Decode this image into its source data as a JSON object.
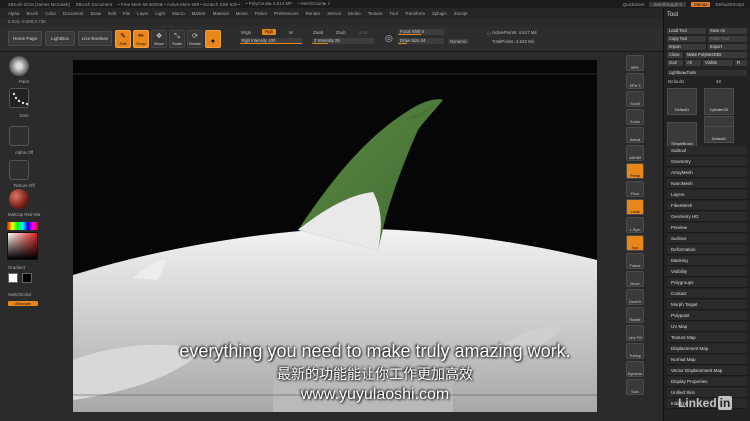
{
  "titlebar": {
    "app": "ZBrush 2018 [James McCaleb]",
    "doc": "ZBrush Document",
    "mem": "• Free Mem 58.303GB • Active Mem 599 • Scratch Disk 530 •",
    "poly": "• PolyCount▸ 4.614 MP",
    "mesh": "• MeshCount▸ 1",
    "quicksave": "QuickSave",
    "seethrough": "See-through  0",
    "menus": "Menus",
    "script": "DefaultZScript"
  },
  "menubar": [
    "Alpha",
    "Brush",
    "Color",
    "Document",
    "Draw",
    "Edit",
    "File",
    "Layer",
    "Light",
    "Macro",
    "Marker",
    "Material",
    "Movie",
    "Picker",
    "Preferences",
    "Render",
    "Stencil",
    "Stroke",
    "Texture",
    "Tool",
    "Transform",
    "Zplugin",
    "Zscript"
  ],
  "coords": "0.034,-0.088,0.736",
  "shelf": {
    "home": "Home Page",
    "lightbox": "LightBox",
    "live_boolean": "Live Boolean",
    "tools": [
      "Edit",
      "Draw",
      "Move",
      "Scale",
      "Rotate"
    ],
    "mrgb": "Mrgb",
    "rgb": "Rgb",
    "m": "M",
    "rgb_intensity": "Rgb Intensity 100",
    "zadd": "Zadd",
    "zsub": "Zsub",
    "zcut": "Zcut",
    "z_intensity": "Z Intensity 25",
    "focal_shift": "Focal Shift 0",
    "draw_size": "Draw Size 24",
    "dynamic": "Dynamic",
    "active_points": "ActivePoints: 4.617 Mil",
    "total_points": "TotalPoints: 4.632 Mil"
  },
  "left": {
    "brush": "Paint",
    "stroke": "Dots",
    "alpha": "Alpha Off",
    "texture": "Texture Off",
    "material": "MatCap Red Wa",
    "gradient": "Gradient",
    "switch": "SwitchColor",
    "alternate": "Alternate"
  },
  "right_tools": [
    "BPR",
    "SPix 3",
    "Scroll",
    "Zoom",
    "Actual",
    "AAHalf",
    "Persp",
    "Floor",
    "Local",
    "L.Sym",
    "Xyz",
    "Frame",
    "Move",
    "ZoomD",
    "Rotate",
    "Line Fill",
    "Transp",
    "Dynamic",
    "Solo"
  ],
  "tool_panel": {
    "title": "Tool",
    "load": "Load Tool",
    "save": "Save As",
    "copy": "Copy Tool",
    "paste": "Paste Tool",
    "import": "Import",
    "export": "Export",
    "clone": "Clone",
    "make_poly": "Make PolyMesh3D",
    "goz": "GoZ",
    "all": "All",
    "visible": "Visible",
    "r": "R",
    "lightbox_tools": "Lightbox▸Tools",
    "default_name": "Default1",
    "default_count": "48",
    "thumbs": [
      "Default1",
      "Cylinder3D",
      "PolyMesh3D",
      "SimpleBrush",
      "Default1"
    ],
    "subpalettes": [
      "Subtool",
      "Geometry",
      "ArrayMesh",
      "NanoMesh",
      "Layers",
      "FiberMesh",
      "Geometry HD",
      "Preview",
      "Surface",
      "Deformation",
      "Masking",
      "Visibility",
      "Polygroups",
      "Contact",
      "Morph Target",
      "Polypaint",
      "UV Map",
      "Texture Map",
      "Displacement Map",
      "Normal Map",
      "Vector Displacement Map",
      "Display Properties",
      "Unified Skin",
      "Initialize"
    ]
  },
  "subtitles": {
    "en": "everything you need to make truly amazing work.",
    "cn": "最新的功能能让你工作更加高效",
    "url": "www.yuyulaoshi.com"
  },
  "watermark": "Linked",
  "watermark_in": "in",
  "colors": {
    "accent": "#e8861a",
    "fin": "#4f7a3a",
    "background": "#2a2a2a"
  }
}
